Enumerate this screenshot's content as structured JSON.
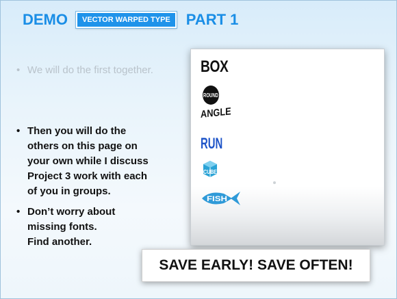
{
  "header": {
    "left_word": "DEMO",
    "badge": "VECTOR WARPED TYPE",
    "right_word": "PART 1"
  },
  "bullets_gray": [
    {
      "text": "We will do the first together."
    }
  ],
  "bullets_main": [
    {
      "lines": [
        "Then you will do the",
        "others on this page on",
        "your own while I discuss",
        "Project 3 work with each",
        "of you in groups."
      ]
    },
    {
      "lines": [
        "Don’t worry about",
        "missing fonts.",
        "Find another."
      ]
    }
  ],
  "bullet_char": "•",
  "panel": {
    "words": {
      "box": "BOX",
      "round": "ROUND",
      "angle": "ANGLE",
      "run": "RUN",
      "cube": "CUBE",
      "fish": "FISH"
    }
  },
  "banner": "SAVE EARLY! SAVE OFTEN!",
  "colors": {
    "accent": "#1a8ee6",
    "badge_bg": "#1f93ea",
    "run_blue": "#1e54c8",
    "run_red": "#d42424",
    "fish_teal": "#2f9ad8",
    "cube_teal": "#2aa3d6"
  }
}
